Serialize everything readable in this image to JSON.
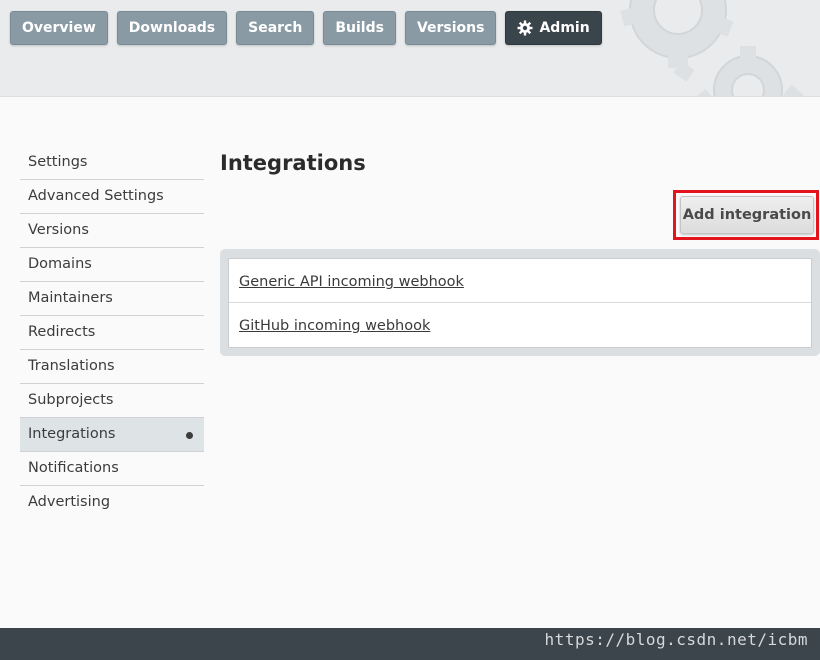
{
  "nav": {
    "items": [
      {
        "label": "Overview"
      },
      {
        "label": "Downloads"
      },
      {
        "label": "Search"
      },
      {
        "label": "Builds"
      },
      {
        "label": "Versions"
      }
    ],
    "admin": {
      "label": "Admin",
      "icon": "gear-icon"
    }
  },
  "sidebar": {
    "items": [
      {
        "label": "Settings"
      },
      {
        "label": "Advanced Settings"
      },
      {
        "label": "Versions"
      },
      {
        "label": "Domains"
      },
      {
        "label": "Maintainers"
      },
      {
        "label": "Redirects"
      },
      {
        "label": "Translations"
      },
      {
        "label": "Subprojects"
      },
      {
        "label": "Integrations",
        "active": true
      },
      {
        "label": "Notifications"
      },
      {
        "label": "Advertising"
      }
    ],
    "active_bullet": "●"
  },
  "main": {
    "title": "Integrations",
    "add_button_label": "Add integration",
    "integrations": [
      {
        "label": "Generic API incoming webhook"
      },
      {
        "label": "GitHub incoming webhook"
      }
    ]
  },
  "footer": {
    "watermark": "https://blog.csdn.net/icbm"
  },
  "colors": {
    "nav_button": "#8a9aa5",
    "nav_active": "#3a444b",
    "highlight": "#e3141d",
    "footer": "#3c454c"
  }
}
